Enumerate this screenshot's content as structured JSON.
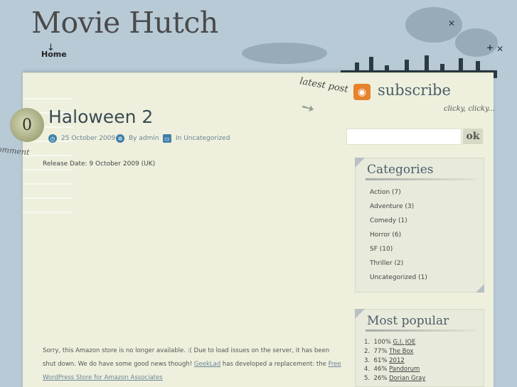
{
  "site": {
    "title": "Movie Hutch",
    "nav": [
      {
        "label": "Home"
      }
    ]
  },
  "post": {
    "comment_count": "0",
    "comment_label": "omment",
    "title": "Haloween 2",
    "date": "25 October 2009",
    "author": "By admin",
    "category": "In Uncategorized",
    "release": "Release Date: 9 October 2009 (UK)",
    "notice_text_1": "Sorry, this Amazon store is no longer available. :( Due to load issues on the server, it has been shut down. We do have some good news though! ",
    "notice_link_1": "GeekLad",
    "notice_text_2": " has developed a replacement: the ",
    "notice_link_2": "Free WordPress Store for Amazon Associates"
  },
  "sidebar": {
    "latest_post": "latest post",
    "subscribe": "subscribe",
    "clicky": "clicky, clicky...",
    "search": {
      "placeholder": "",
      "button": "ok"
    },
    "categories": {
      "title": "Categories",
      "items": [
        {
          "label": "Action (7)"
        },
        {
          "label": "Adventure (3)"
        },
        {
          "label": "Comedy (1)"
        },
        {
          "label": "Horror (6)"
        },
        {
          "label": "SF (10)"
        },
        {
          "label": "Thriller (2)"
        },
        {
          "label": "Uncategorized (1)"
        }
      ]
    },
    "popular": {
      "title": "Most popular",
      "items": [
        {
          "num": "1.",
          "pct": "100%",
          "title": "G.I. JOE"
        },
        {
          "num": "2.",
          "pct": "77%",
          "title": "The Box"
        },
        {
          "num": "3.",
          "pct": "61%",
          "title": "2012"
        },
        {
          "num": "4.",
          "pct": "46%",
          "title": "Pandorum"
        },
        {
          "num": "5.",
          "pct": "26%",
          "title": "Dorian Gray"
        }
      ]
    }
  },
  "icons": {
    "date": "clock-icon",
    "author": "gear-icon",
    "category": "folder-icon",
    "rss": "rss-icon"
  },
  "colors": {
    "background": "#b7cad6",
    "paper": "#eef0dd",
    "accent": "#3f7fa8",
    "rss": "#e8822a"
  }
}
